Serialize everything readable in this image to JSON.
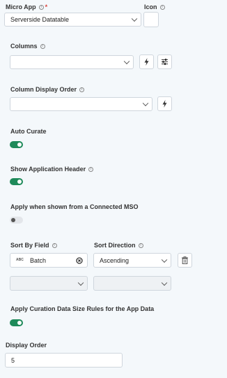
{
  "micro_app": {
    "label": "Micro App",
    "required_mark": "*",
    "value": "Serverside Datatable"
  },
  "icon_field": {
    "label": "Icon"
  },
  "columns": {
    "label": "Columns",
    "value": ""
  },
  "column_display_order": {
    "label": "Column Display Order",
    "value": ""
  },
  "auto_curate": {
    "label": "Auto Curate",
    "on": true
  },
  "show_app_header": {
    "label": "Show Application Header",
    "on": true
  },
  "apply_connected_mso": {
    "label": "Apply when shown from a Connected MSO",
    "on": false
  },
  "sort_by_field": {
    "label": "Sort By Field",
    "type_badge": "ABC",
    "value": "Batch"
  },
  "sort_direction": {
    "label": "Sort Direction",
    "value": "Ascending"
  },
  "curation_rules": {
    "label": "Apply Curation Data Size Rules for the App Data",
    "on": true
  },
  "display_order": {
    "label": "Display Order",
    "value": "5"
  },
  "info_glyph": "i",
  "colors": {
    "toggle_on": "#1e8a5a",
    "required": "#d9453d",
    "background": "#f4f8fb"
  }
}
